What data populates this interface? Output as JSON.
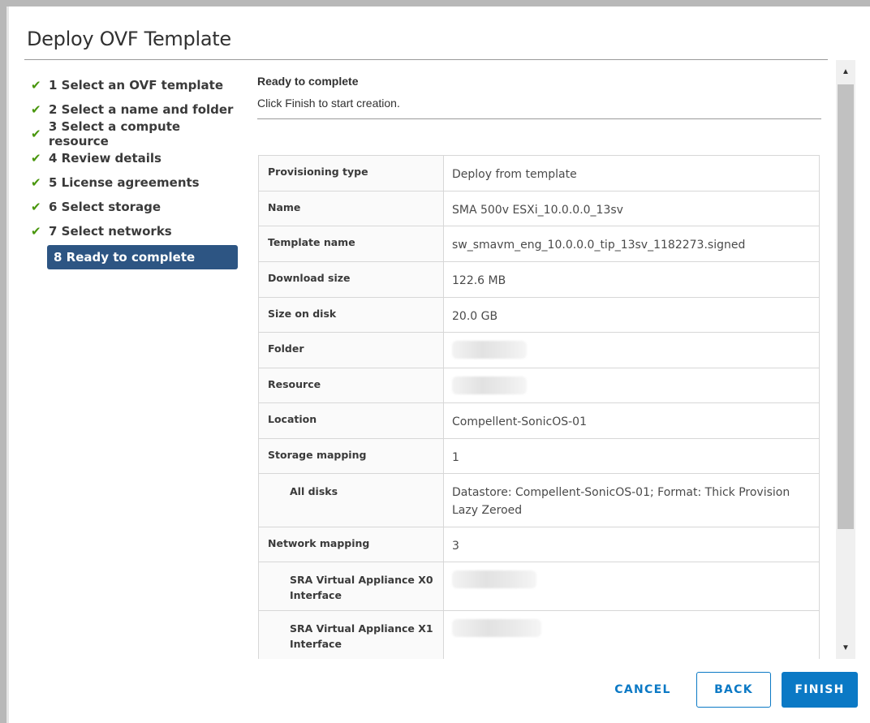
{
  "dialog": {
    "title": "Deploy OVF Template"
  },
  "steps": [
    {
      "label": "1 Select an OVF template",
      "done": true
    },
    {
      "label": "2 Select a name and folder",
      "done": true
    },
    {
      "label": "3 Select a compute resource",
      "done": true
    },
    {
      "label": "4 Review details",
      "done": true
    },
    {
      "label": "5 License agreements",
      "done": true
    },
    {
      "label": "6 Select storage",
      "done": true
    },
    {
      "label": "7 Select networks",
      "done": true
    },
    {
      "label": "8 Ready to complete",
      "done": false,
      "active": true
    }
  ],
  "content": {
    "heading": "Ready to complete",
    "subheading": "Click Finish to start creation."
  },
  "summary": [
    {
      "label": "Provisioning type",
      "value": "Deploy from template"
    },
    {
      "label": "Name",
      "value": "SMA 500v ESXi_10.0.0.0_13sv"
    },
    {
      "label": "Template name",
      "value": "sw_smavm_eng_10.0.0.0_tip_13sv_1182273.signed"
    },
    {
      "label": "Download size",
      "value": "122.6 MB"
    },
    {
      "label": "Size on disk",
      "value": "20.0 GB"
    },
    {
      "label": "Folder",
      "value": ""
    },
    {
      "label": "Resource",
      "value": ""
    },
    {
      "label": "Location",
      "value": "Compellent-SonicOS-01"
    },
    {
      "label": "Storage mapping",
      "value": "1"
    },
    {
      "label": "All disks",
      "value": "Datastore: Compellent-SonicOS-01; Format: Thick Provision Lazy Zeroed"
    },
    {
      "label": "Network mapping",
      "value": "3"
    },
    {
      "label": "SRA Virtual Appliance X0 Interface",
      "value": ""
    },
    {
      "label": "SRA Virtual Appliance X1 Interface",
      "value": ""
    }
  ],
  "buttons": {
    "cancel": "CANCEL",
    "back": "BACK",
    "finish": "FINISH"
  },
  "icons": {
    "step_done": "checkmark-icon",
    "scroll_up": "arrow-up-icon",
    "scroll_down": "arrow-down-icon"
  },
  "colors": {
    "accent": "#0b79c5",
    "active_step": "#2d5583",
    "check": "#48960c"
  }
}
